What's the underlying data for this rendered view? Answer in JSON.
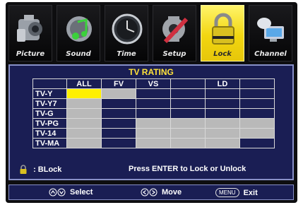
{
  "tabs": [
    {
      "label": "Picture",
      "icon": "camera-icon"
    },
    {
      "label": "Sound",
      "icon": "music-note-icon"
    },
    {
      "label": "Time",
      "icon": "clock-icon"
    },
    {
      "label": "Setup",
      "icon": "gear-wrench-icon"
    },
    {
      "label": "Lock",
      "icon": "padlock-icon",
      "active": true
    },
    {
      "label": "Channel",
      "icon": "satellite-dish-icon"
    }
  ],
  "panel": {
    "title": "TV RATING",
    "columns": [
      "ALL",
      "FV",
      "VS",
      "",
      "LD",
      ""
    ],
    "rows": [
      "TV-Y",
      "TV-Y7",
      "TV-G",
      "TV-PG",
      "TV-14",
      "TV-MA"
    ]
  },
  "hint": {
    "block_label": ": BLock",
    "instruction": "Press ENTER to Lock or Unlock"
  },
  "bottom_bar": {
    "select_label": "Select",
    "move_label": "Move",
    "menu_key": "MENU",
    "exit_label": "Exit"
  },
  "colors": {
    "accent_yellow": "#fff000",
    "panel_bg": "#1a1e54",
    "cell_gray": "#b9b9b9",
    "title_yellow": "#ffe23a"
  }
}
